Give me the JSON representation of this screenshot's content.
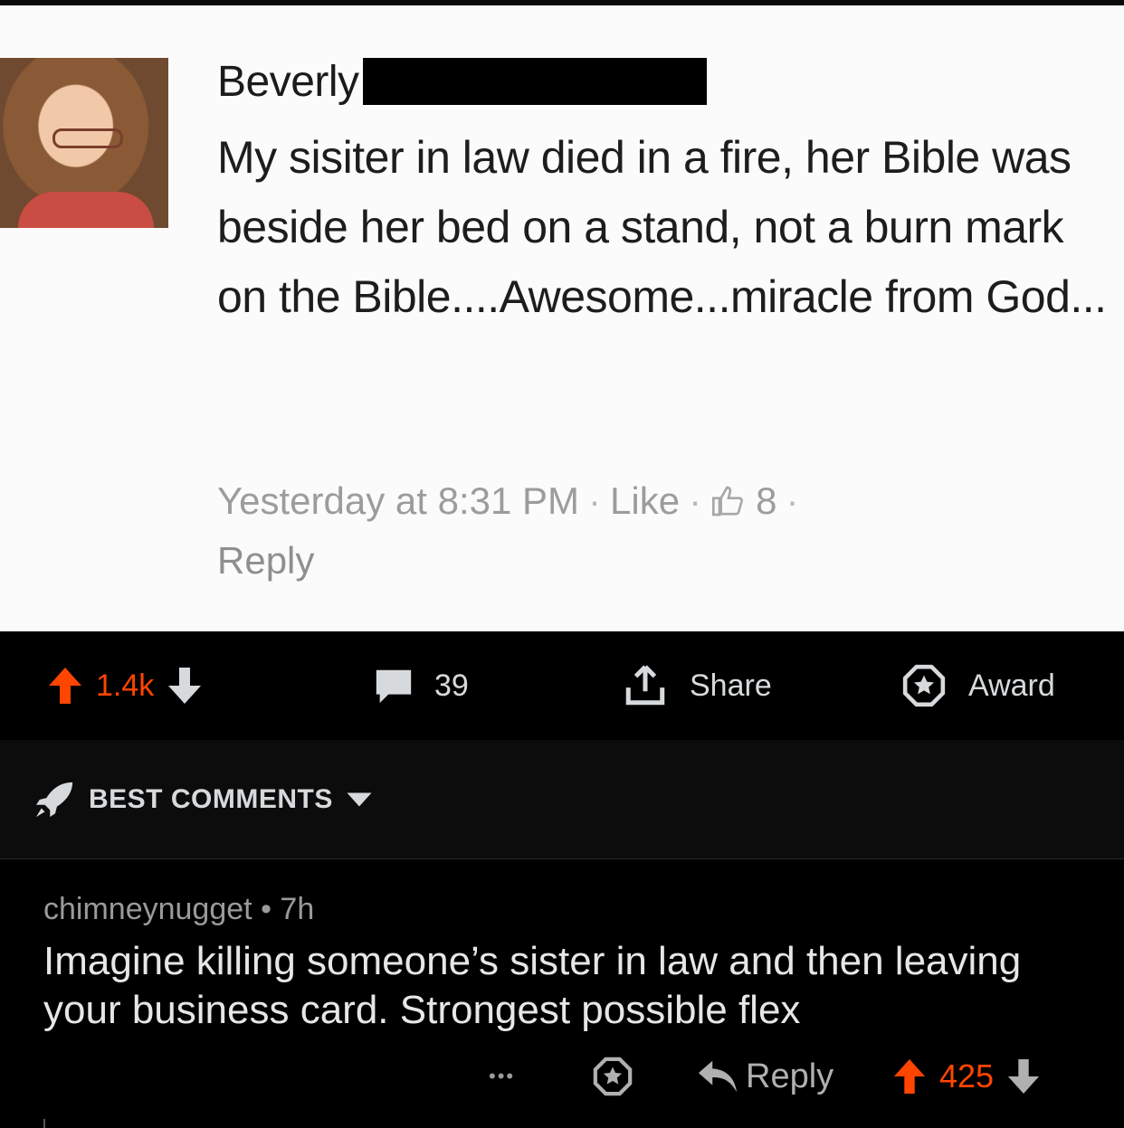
{
  "post_image": {
    "author": "Beverly",
    "text": "My sisiter in law died in a fire, her Bible was beside her bed on a stand, not a burn mark on the Bible....Awesome...miracle from God...",
    "timestamp": "Yesterday at 8:31 PM",
    "like_label": "Like",
    "like_count": "8",
    "reply_label": "Reply",
    "separator": "·"
  },
  "post_actions": {
    "vote_count": "1.4k",
    "comment_count": "39",
    "share_label": "Share",
    "award_label": "Award"
  },
  "sort": {
    "label": "BEST COMMENTS"
  },
  "comment": {
    "username": "chimneynugget",
    "age": "7h",
    "meta_separator": "•",
    "body": "Imagine killing someone’s sister in law and then leaving your business card. Strongest possible flex",
    "reply_label": "Reply",
    "score": "425",
    "more_label": "•••"
  },
  "colors": {
    "upvote": "#ff4500",
    "background": "#000000",
    "text_primary": "#d7dadc",
    "text_meta": "#9a9a9a"
  },
  "icons": [
    "upvote-icon",
    "downvote-icon",
    "comment-icon",
    "share-icon",
    "award-icon",
    "rocket-icon",
    "caret-down-icon",
    "reply-arrow-icon",
    "thumbs-up-icon",
    "more-icon"
  ]
}
